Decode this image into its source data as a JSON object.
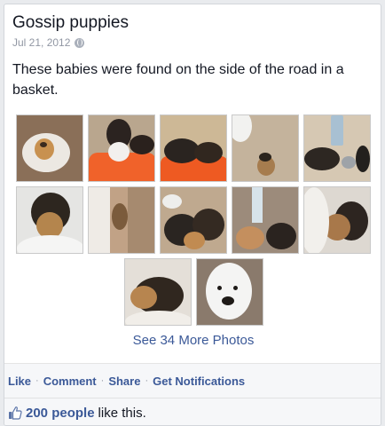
{
  "post": {
    "title": "Gossip puppies",
    "date": "Jul 21, 2012",
    "privacy_icon": "globe-icon",
    "message": "These babies were found on the side of the road in a basket."
  },
  "photos": [
    [
      "photo-puppy-on-pillow",
      "photo-puppies-orange-blanket",
      "photo-puppies-sleeping-orange",
      "photo-puppy-floor",
      "photo-puppies-group-bowls"
    ],
    [
      "photo-puppy-white-towel",
      "photo-puppy-corner",
      "photo-puppies-pile",
      "photo-puppies-window",
      "photo-puppy-towel-closeup"
    ],
    [
      "photo-puppy-sleeping-pillow",
      "photo-white-puppy-face"
    ]
  ],
  "see_more": "See 34 More Photos",
  "actions": {
    "like": "Like",
    "comment": "Comment",
    "share": "Share",
    "notifications": "Get Notifications",
    "separator": "·"
  },
  "likes": {
    "icon": "thumbs-up-icon",
    "count_link": "200 people",
    "suffix": "like this."
  },
  "colors": {
    "link": "#3b5998",
    "text": "#141823",
    "meta": "#9197a3",
    "bar_bg": "#f6f7f9"
  }
}
